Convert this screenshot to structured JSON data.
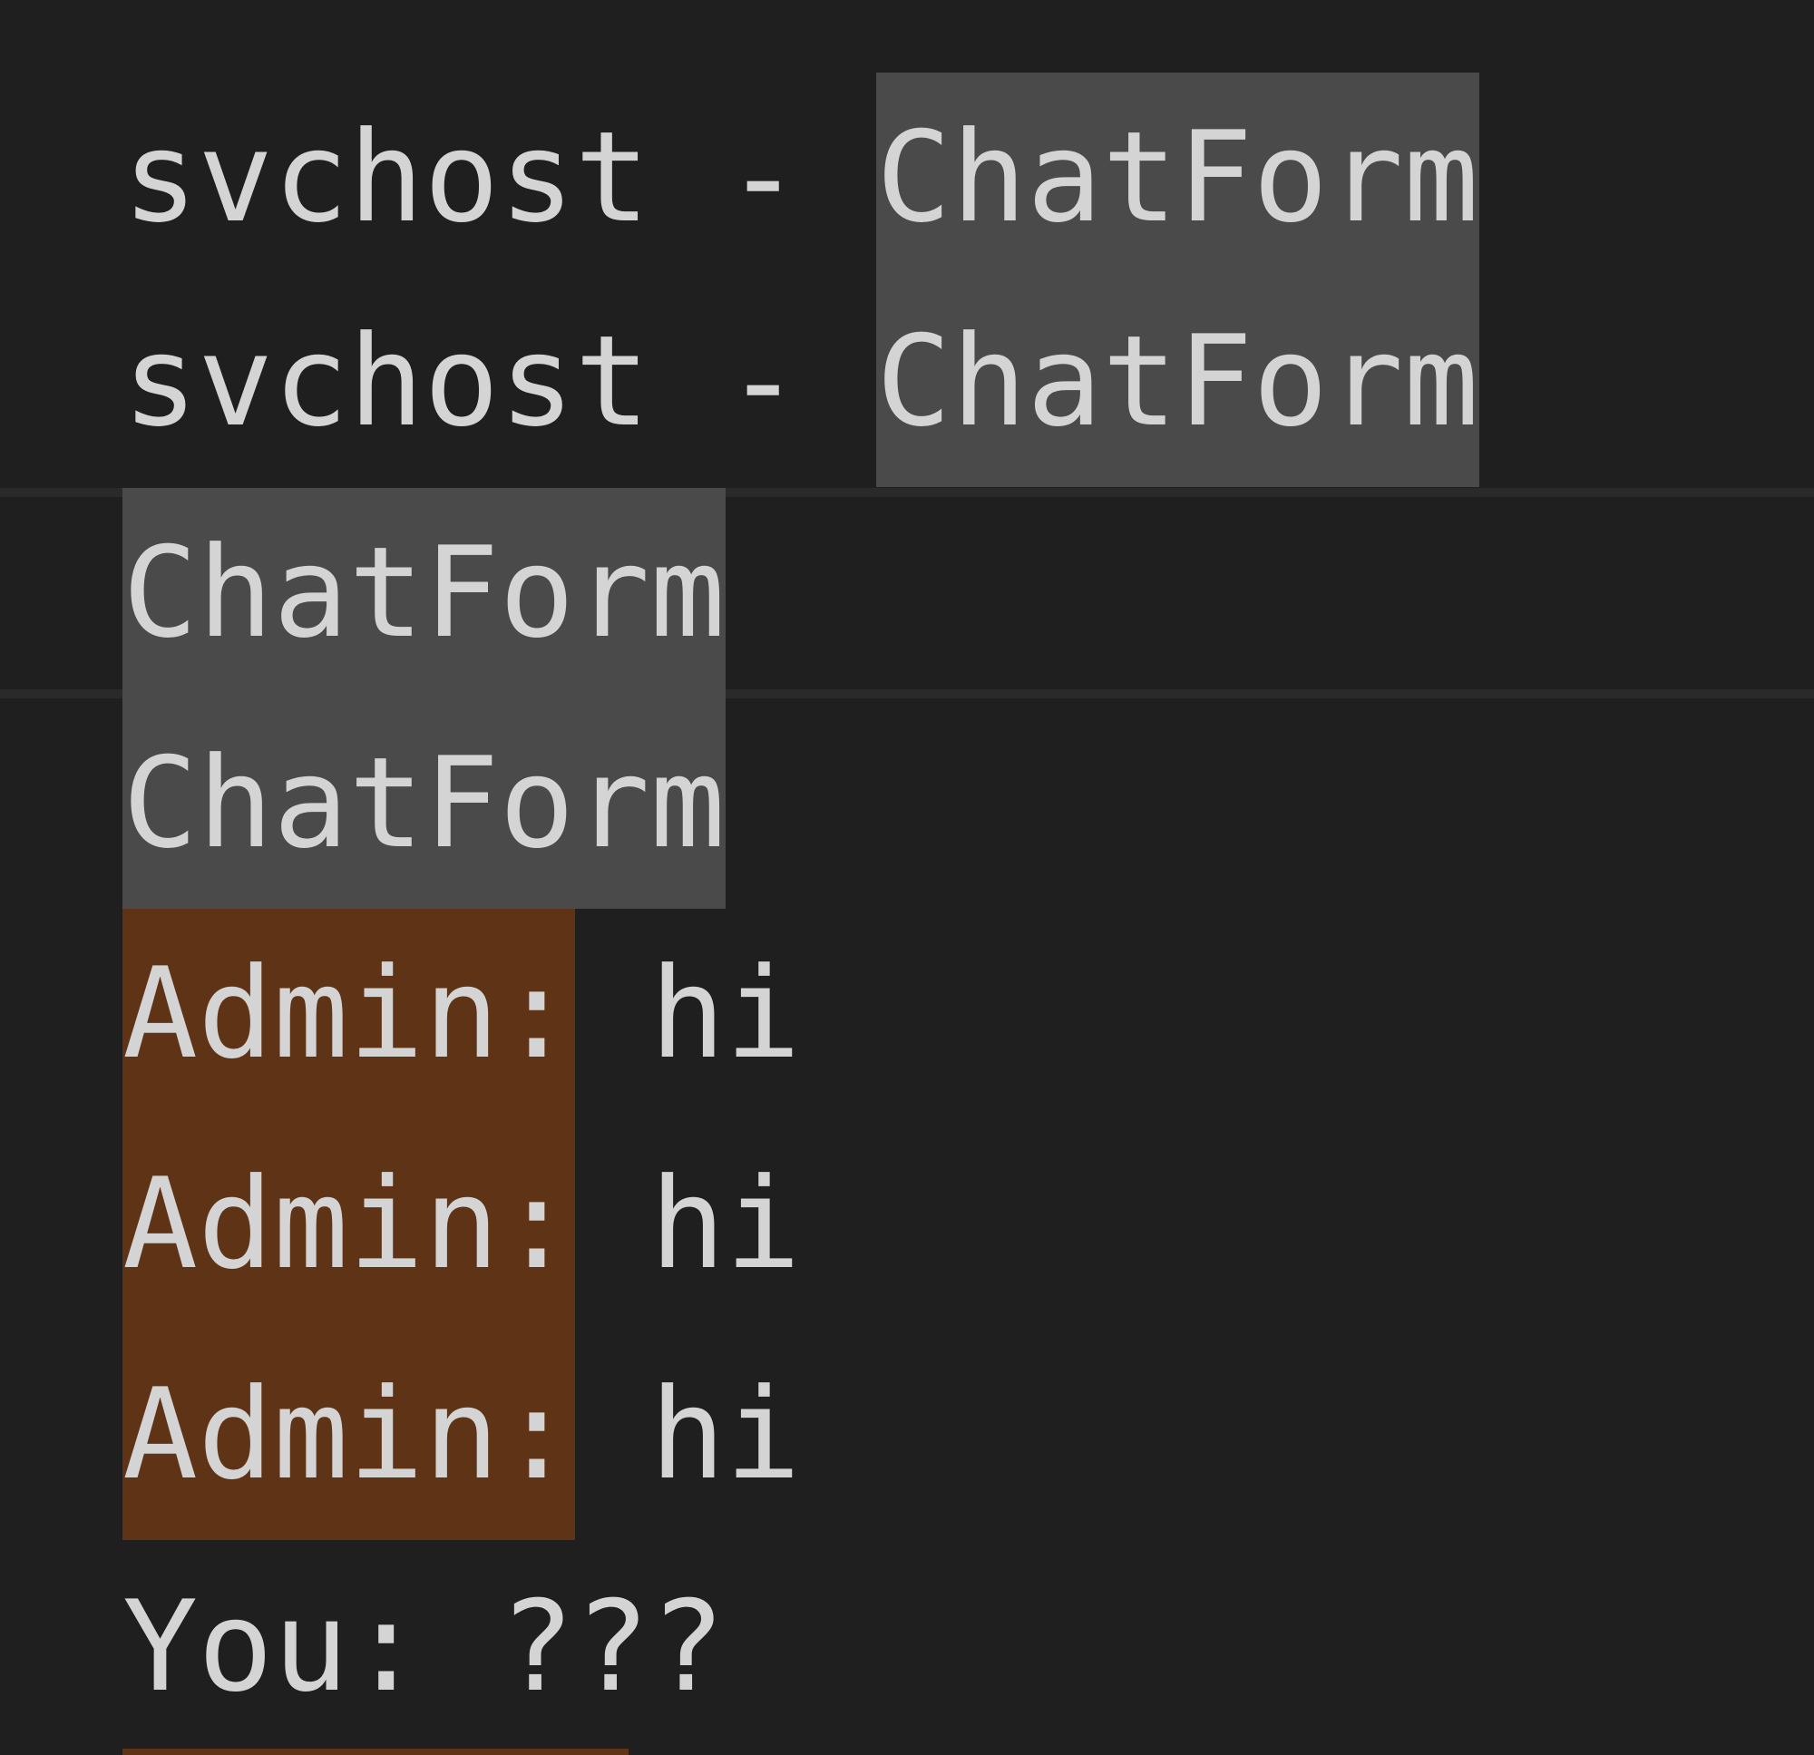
{
  "colors": {
    "background": "#1f1f1f",
    "text": "#d4d4d4",
    "selection_match_highlight": "#4a4a4a",
    "find_match_highlight": "#5f3316",
    "current_line_border": "#2a2a2a"
  },
  "editor": {
    "lines": [
      {
        "prefix": "svchost",
        "before": "",
        "highlight": "",
        "after": ""
      },
      {
        "prefix": "svchost - ",
        "highlight": "ChatForm",
        "after": ""
      },
      {
        "prefix": "svchost - ",
        "highlight": "ChatForm",
        "after": ""
      },
      {
        "prefix": "",
        "highlight": "ChatForm",
        "after": ""
      },
      {
        "prefix": "",
        "highlight": "ChatForm",
        "after": ""
      },
      {
        "prefix": "",
        "highlight": "Admin:",
        "after": " hi"
      },
      {
        "prefix": "",
        "highlight": "Admin:",
        "after": " hi"
      },
      {
        "prefix": "",
        "highlight": "Admin:",
        "after": " hi"
      },
      {
        "prefix": "",
        "highlight": "",
        "after": "You: ???"
      }
    ]
  }
}
